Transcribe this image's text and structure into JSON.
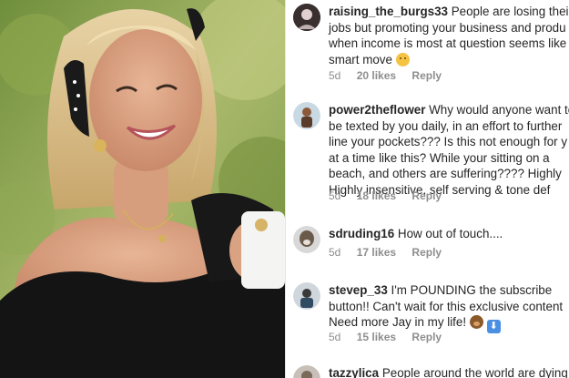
{
  "post": {
    "photo_icon": "portrait-photo"
  },
  "comments": [
    {
      "username": "raising_the_burgs33",
      "lines": [
        "People are losing their",
        "jobs but promoting your business and produ",
        "when income is most at question seems like",
        "smart move"
      ],
      "emoji": "neutral-smile-emoji",
      "age": "5d",
      "likes": "20 likes",
      "reply": "Reply"
    },
    {
      "username": "power2theflower",
      "lines": [
        "Why would anyone want to",
        "be texted by you daily, in an effort to further",
        "line your pockets??? Is this not enough for y",
        "at a time like this? While your sitting on a",
        "beach, and others are suffering???? Highly",
        "Highly insensitive, self serving & tone def"
      ],
      "age": "5d",
      "likes": "18 likes",
      "reply": "Reply"
    },
    {
      "username": "sdruding16",
      "lines": [
        "How out of touch...."
      ],
      "age": "5d",
      "likes": "17 likes",
      "reply": "Reply"
    },
    {
      "username": "stevep_33",
      "lines": [
        "I'm POUNDING the subscribe",
        "button!! Can't wait for this exclusive content",
        "Need more Jay in my life!"
      ],
      "emoji": "bear-emoji",
      "emoji2": "down-arrow-emoji",
      "emoji2_glyph": "⬇",
      "age": "5d",
      "likes": "15 likes",
      "reply": "Reply"
    },
    {
      "username": "tazzylica",
      "lines": [
        "People around the world are dying"
      ]
    }
  ],
  "colors": {
    "text": "#262626",
    "meta": "#8e8e8e",
    "divider": "#e6e6e6"
  }
}
